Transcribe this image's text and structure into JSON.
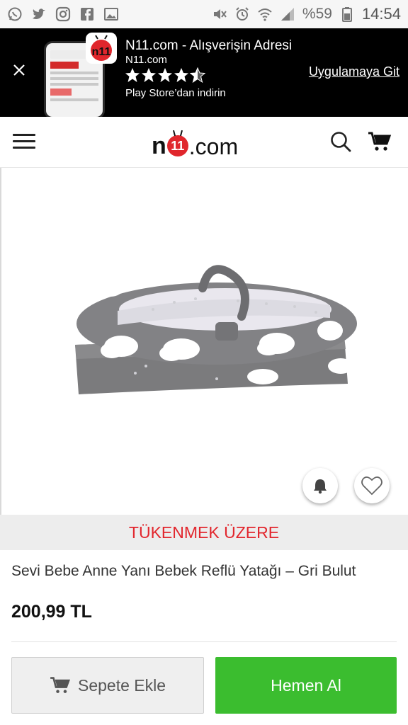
{
  "status_bar": {
    "left_icons": [
      "whatsapp-icon",
      "twitter-icon",
      "instagram-icon",
      "facebook-icon",
      "gallery-icon"
    ],
    "right_icons": [
      "mute-icon",
      "alarm-icon",
      "wifi-icon",
      "signal-icon",
      "battery-icon"
    ],
    "battery": "%59",
    "time": "14:54"
  },
  "app_banner": {
    "title": "N11.com - Alışverişin Adresi",
    "subtitle": "N11.com",
    "rating_stars": 4.5,
    "store_text": "Play Store’dan indirin",
    "cta": "Uygulamaya Git"
  },
  "header": {
    "logo_prefix": "n",
    "logo_badge": "11",
    "logo_suffix": ".com"
  },
  "product": {
    "stock_status": "TÜKENMEK ÜZERE",
    "title": "Sevi Bebe Anne Yanı Bebek Reflü Yatağı – Gri Bulut",
    "price": "200,99 TL"
  },
  "actions": {
    "add_to_cart": "Sepete Ekle",
    "buy_now": "Hemen Al"
  },
  "colors": {
    "accent_red": "#e2262d",
    "buy_green": "#3bbd2f",
    "banner_bg": "#000000"
  }
}
